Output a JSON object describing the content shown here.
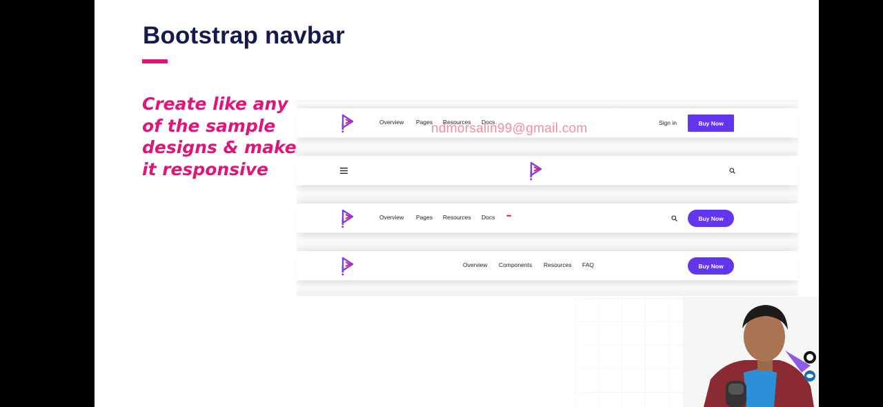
{
  "slide": {
    "title": "Bootstrap navbar",
    "task_lines": [
      "Create like any",
      "of the sample",
      "designs & make",
      "it responsive"
    ],
    "watermark": "ndmorsalin99@gmail.com"
  },
  "navbar1": {
    "links": [
      "Overview",
      "Pages",
      "Resources",
      "Docs"
    ],
    "signin": "Sign in",
    "cta": "Buy Now"
  },
  "navbar2": {
    "menu_icon": "hamburger-icon",
    "search_icon": "search-icon"
  },
  "navbar3": {
    "links": [
      "Overview",
      "Pages",
      "Resources",
      "Docs"
    ],
    "more": "•••",
    "search_icon": "search-icon",
    "cta": "Buy Now"
  },
  "navbar4": {
    "links": [
      "Overview",
      "Components",
      "Resources",
      "FAQ"
    ],
    "cta": "Buy Now"
  },
  "colors": {
    "title": "#141a4d",
    "accent": "#e0157a",
    "button": "#6236ef",
    "logo_purple": "#7b3fe4",
    "logo_pink": "#e0157a"
  }
}
